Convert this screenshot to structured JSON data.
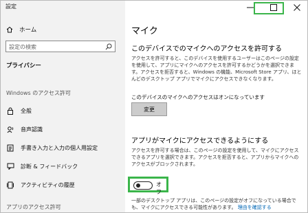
{
  "window": {
    "title": "設定"
  },
  "sidebar": {
    "home_label": "ホーム",
    "search_placeholder": "設定の検索",
    "section_title": "プライバシー",
    "windows_permissions_label": "Windows のアクセス許可",
    "items": [
      {
        "label": "全般",
        "icon": "lock-icon"
      },
      {
        "label": "音声認識",
        "icon": "speech-icon"
      },
      {
        "label": "手書き入力と入力の個人用設定",
        "icon": "pen-note-icon"
      },
      {
        "label": "診断 & フィードバック",
        "icon": "feedback-icon"
      },
      {
        "label": "アクティビティの履歴",
        "icon": "activity-icon"
      }
    ],
    "app_permissions_label": "アプリのアクセス許可"
  },
  "main": {
    "page_title": "マイク",
    "device_section": {
      "heading": "このデバイスでのマイクへのアクセスを許可する",
      "description": "アクセスを許可すると、このデバイスを使用するユーザーはこのページの設定を使用して、アプリにマイクへのアクセスを許可するかどうかを選択できます。アクセスを拒否すると、Windows の機能、Microsoft Store アプリ、ほとんどのデスクトップ アプリでマイクにアクセスできなくなります。",
      "status": "このデバイスのマイクへのアクセスはオンになっています",
      "change_button": "変更"
    },
    "app_section": {
      "heading": "アプリがマイクにアクセスできるようにする",
      "description": "アクセスを許可する場合は、このページの設定を使用して、マイクにアクセスできるアプリを選択できます。アクセスを拒否すると、アプリからマイクへのアクセスがブロックされます。",
      "toggle_label": "オフ",
      "toggle_state": "off"
    },
    "footer_text": "一部のデスクトップ アプリは、このページの設定がオフになっている場合でも、マイクにアクセスできる可能性があります。",
    "footer_link": "理由を確認する"
  },
  "colors": {
    "highlight": "#3ab54a",
    "link": "#0066b4",
    "sidebar_bg": "#f2f2f2"
  }
}
